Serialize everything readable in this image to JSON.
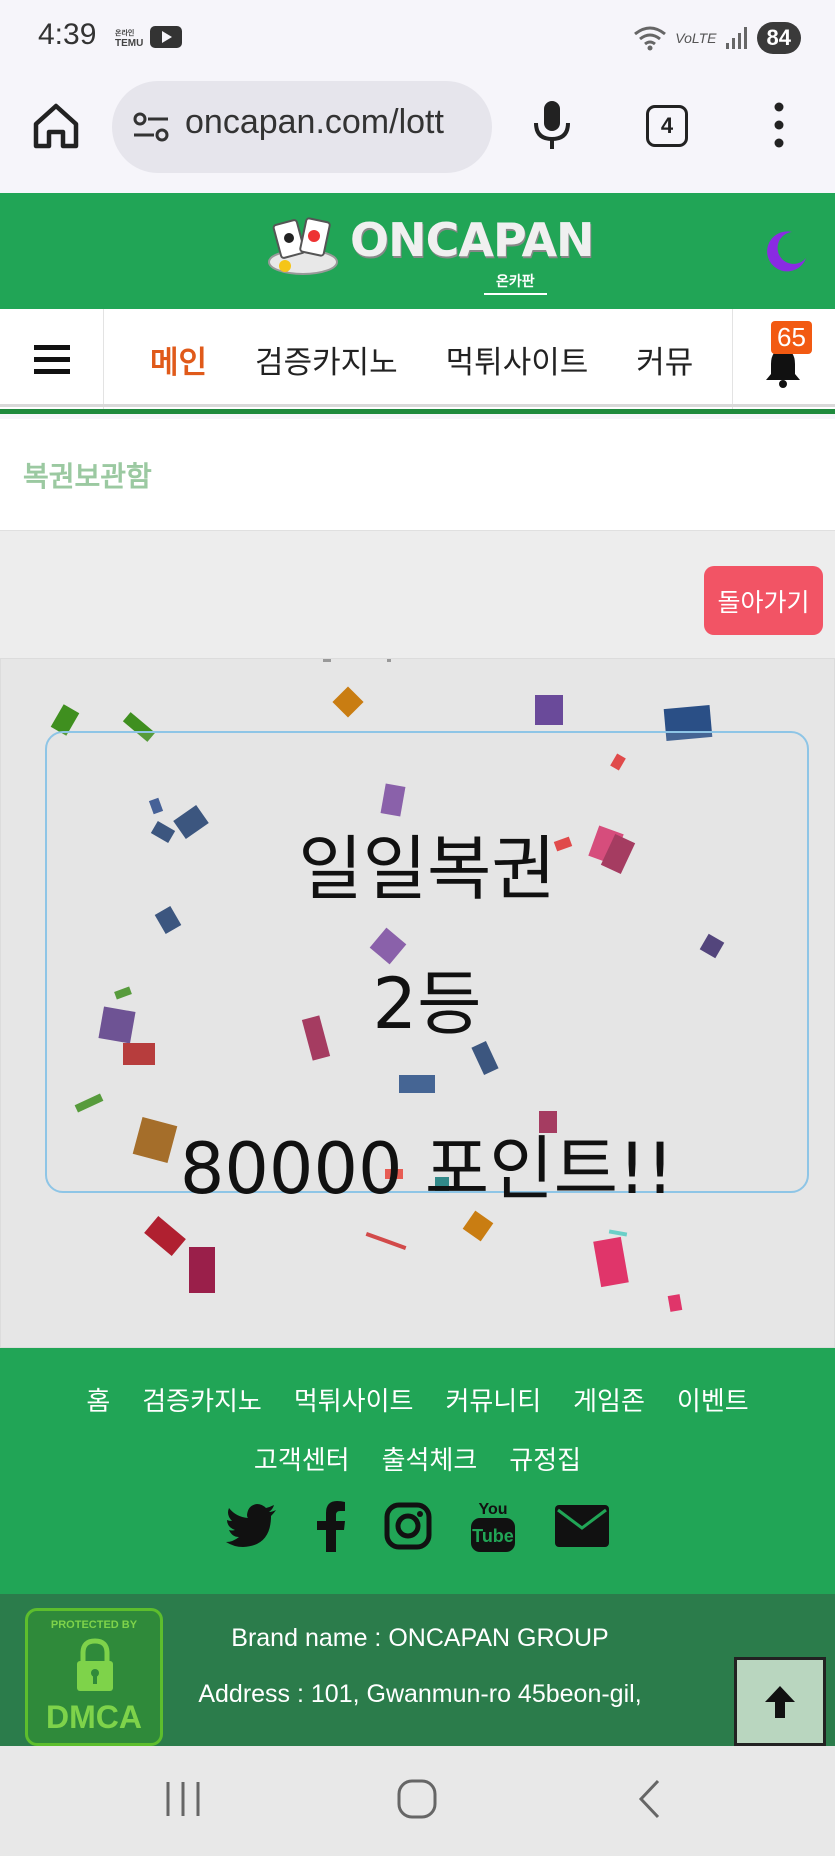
{
  "status_bar": {
    "time": "4:39",
    "notif_icons": [
      "temu-icon",
      "youtube-icon"
    ],
    "temu_label": "TEMU",
    "network": "VoLTE",
    "battery": "84"
  },
  "browser": {
    "url": "oncapan.com/lott",
    "tab_count": "4"
  },
  "site": {
    "logo_text": "ONCAPAN",
    "logo_subtext": "온카판",
    "brand_color": "#21a556"
  },
  "nav": {
    "items": [
      {
        "label": "메인",
        "active": true
      },
      {
        "label": "검증카지노",
        "active": false
      },
      {
        "label": "먹튀사이트",
        "active": false
      },
      {
        "label": "커뮤",
        "active": false
      }
    ],
    "notification_count": "65"
  },
  "page": {
    "title": "복권보관함",
    "back_label": "돌아가기"
  },
  "result": {
    "lottery_name": "일일복권",
    "rank": "2등",
    "prize": "80000 포인트!!"
  },
  "footer": {
    "links": [
      "홈",
      "검증카지노",
      "먹튀사이트",
      "커뮤니티",
      "게임존",
      "이벤트",
      "고객센터",
      "출석체크",
      "규정집"
    ],
    "social": [
      "twitter-icon",
      "facebook-icon",
      "instagram-icon",
      "youtube-icon",
      "mail-icon"
    ],
    "dmca_top": "PROTECTED BY",
    "dmca_bottom": "DMCA",
    "brand_line": "Brand name : ONCAPAN GROUP",
    "address_line": "Address : 101, Gwanmun-ro 45beon-gil,"
  }
}
